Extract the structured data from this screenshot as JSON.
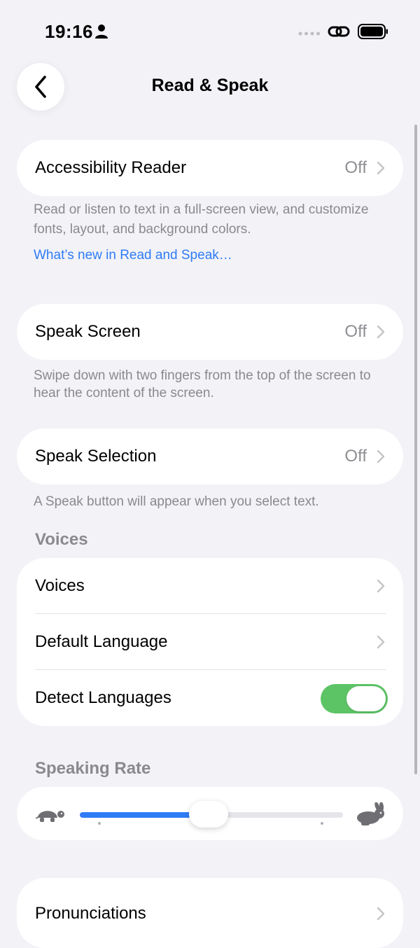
{
  "status_bar": {
    "time": "19:16"
  },
  "nav": {
    "title": "Read & Speak"
  },
  "accessibility_reader": {
    "label": "Accessibility Reader",
    "value": "Off",
    "footer": "Read or listen to text in a full-screen view, and customize fonts, layout, and background colors.",
    "link": "What’s new in Read and Speak…"
  },
  "speak_screen": {
    "label": "Speak Screen",
    "value": "Off",
    "footer": "Swipe down with two fingers from the top of the screen to hear the content of the screen."
  },
  "speak_selection": {
    "label": "Speak Selection",
    "value": "Off",
    "footer": "A Speak button will appear when you select text."
  },
  "voices_section": {
    "header": "Voices",
    "items": [
      {
        "label": "Voices"
      },
      {
        "label": "Default Language"
      },
      {
        "label": "Detect Languages",
        "toggle_on": true
      }
    ]
  },
  "speaking_rate": {
    "header": "Speaking Rate",
    "value_fraction": 0.49
  },
  "pronunciations": {
    "label": "Pronunciations"
  },
  "colors": {
    "accent": "#2F7CF6",
    "toggle_on": "#5DC466",
    "background": "#F2F2F7"
  }
}
